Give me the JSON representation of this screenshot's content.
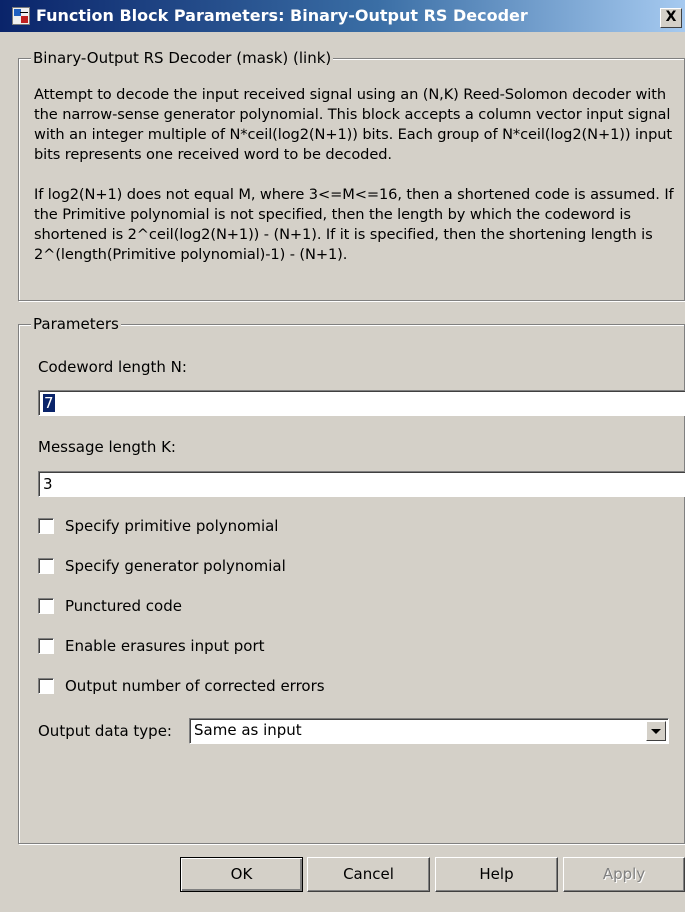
{
  "window": {
    "title": "Function Block Parameters: Binary-Output RS Decoder",
    "close_label": "X"
  },
  "description": {
    "legend": "Binary-Output RS Decoder (mask) (link)",
    "text": "Attempt to decode the input received signal using an (N,K) Reed-Solomon decoder with the narrow-sense generator polynomial.  This block accepts a column vector input signal with an integer multiple of N*ceil(log2(N+1)) bits.  Each group of N*ceil(log2(N+1)) input bits represents one received word to be decoded.\n\nIf log2(N+1) does not equal M, where 3<=M<=16, then a shortened code is assumed.  If the Primitive polynomial is not specified, then the length by which the codeword is shortened is 2^ceil(log2(N+1)) - (N+1).  If it is specified, then the shortening length is 2^(length(Primitive polynomial)-1) - (N+1)."
  },
  "parameters": {
    "legend": "Parameters",
    "codeword_length": {
      "label": "Codeword length N:",
      "value": "7"
    },
    "message_length": {
      "label": "Message length K:",
      "value": "3"
    },
    "checkboxes": [
      {
        "label": "Specify primitive polynomial",
        "checked": false
      },
      {
        "label": "Specify generator polynomial",
        "checked": false
      },
      {
        "label": "Punctured code",
        "checked": false
      },
      {
        "label": "Enable erasures input port",
        "checked": false
      },
      {
        "label": "Output number of corrected errors",
        "checked": false
      }
    ],
    "output_data_type": {
      "label": "Output data type:",
      "value": "Same as input"
    }
  },
  "buttons": {
    "ok": "OK",
    "cancel": "Cancel",
    "help": "Help",
    "apply": "Apply"
  }
}
